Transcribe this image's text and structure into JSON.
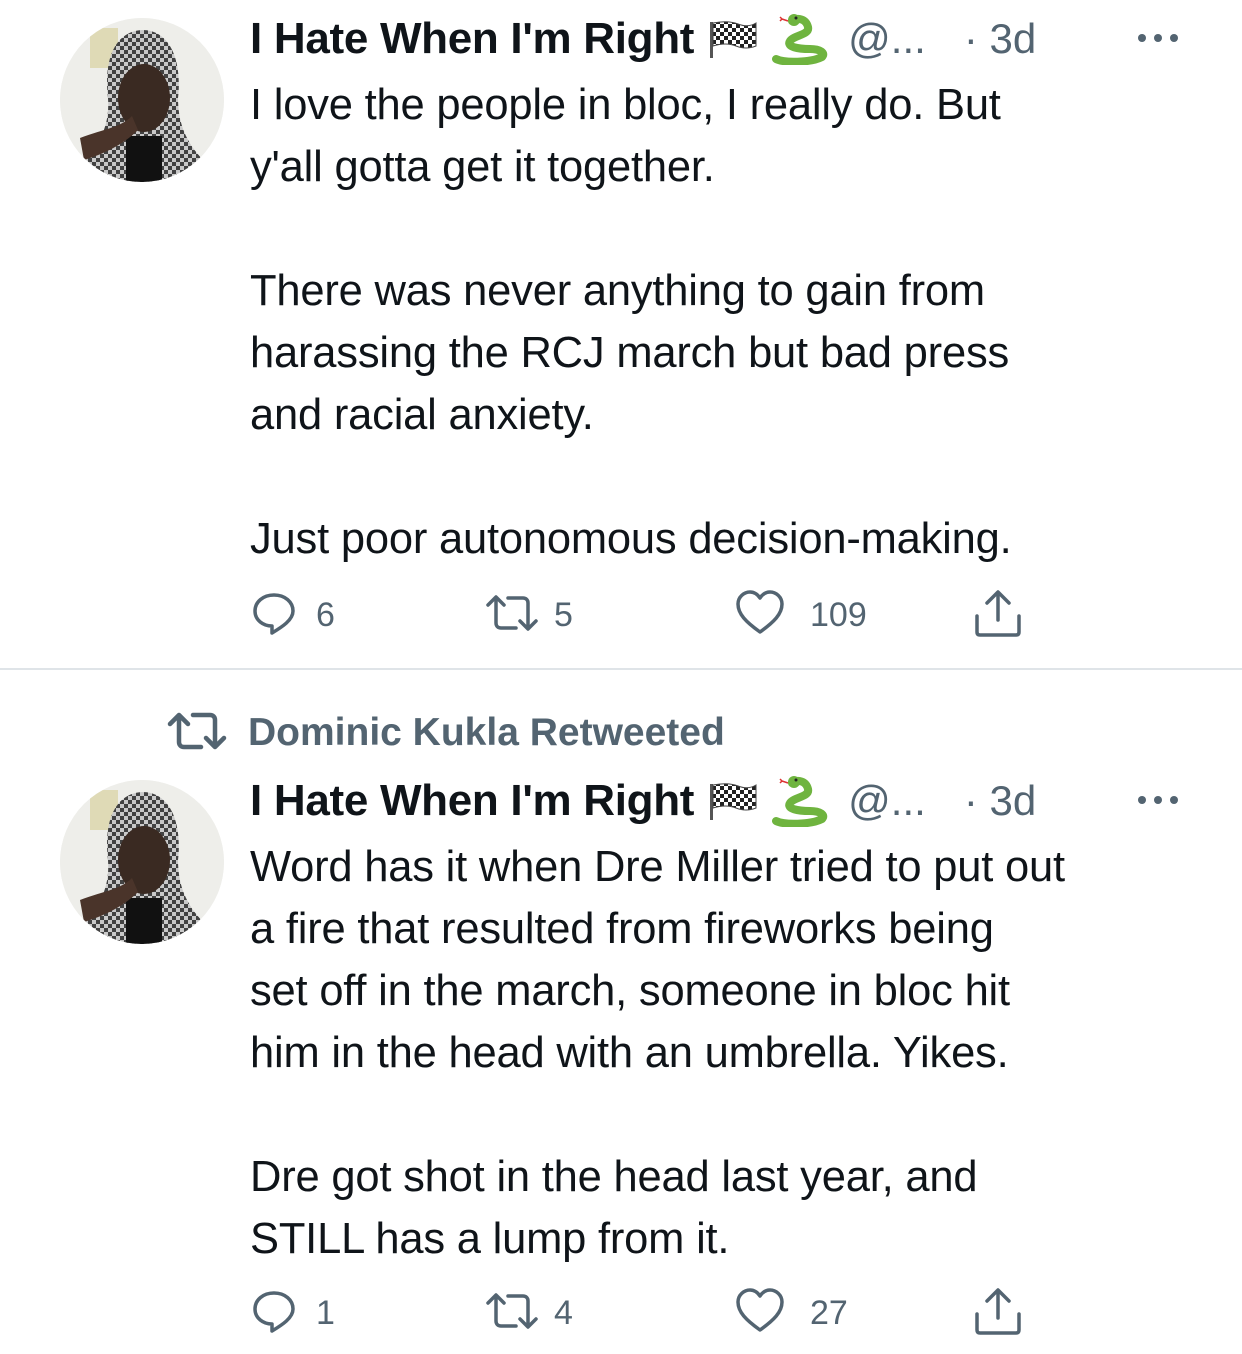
{
  "tweets": [
    {
      "display_name": "I Hate When I'm Right",
      "name_emoji": [
        "chequered-flag",
        "snake"
      ],
      "handle": "@...",
      "time": "· 3d",
      "text": "I love the people in bloc, I really do. But\ny'all gotta get it together.\n\nThere was never anything to gain from\nharassing the RCJ march but bad press\nand racial anxiety.\n\nJust poor autonomous decision-making.",
      "reply_count": "6",
      "retweet_count": "5",
      "like_count": "109"
    },
    {
      "retweeted_by": "Dominic Kukla Retweeted",
      "display_name": "I Hate When I'm Right",
      "name_emoji": [
        "chequered-flag",
        "snake"
      ],
      "handle": "@...",
      "time": "· 3d",
      "text": "Word has it when Dre Miller tried to put out\na fire that resulted from fireworks being\nset off in the march, someone in bloc hit\nhim in the head with an umbrella. Yikes.\n\nDre got shot in the head last year, and\nSTILL has a lump from it.",
      "reply_count": "1",
      "retweet_count": "4",
      "like_count": "27"
    }
  ],
  "colors": {
    "text": "#0f1419",
    "secondary": "#536471",
    "divider": "#dfe4e8",
    "snake_green": "#6fb43f"
  },
  "icons": [
    "reply-icon",
    "retweet-icon",
    "like-icon",
    "share-icon",
    "more-icon",
    "retweet-context-icon"
  ]
}
